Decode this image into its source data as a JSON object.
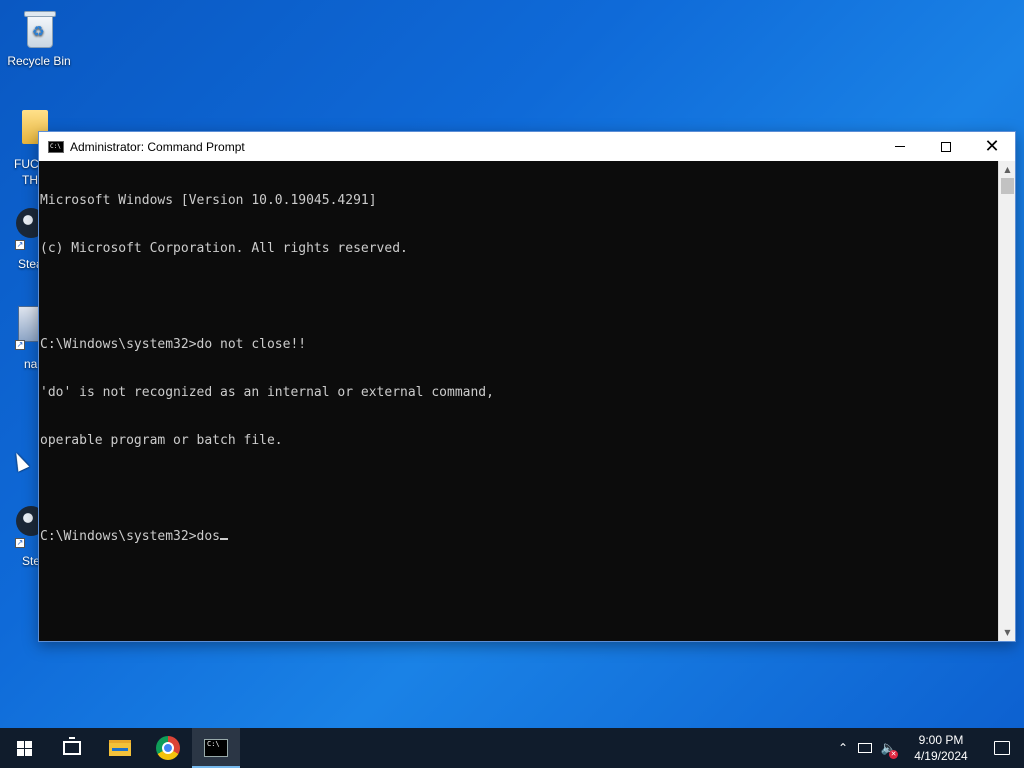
{
  "desktop": {
    "recycle_bin_label": "Recycle Bin",
    "partial_labels": [
      "FUCI",
      "THI",
      "Stea",
      "na",
      "Ste"
    ]
  },
  "window": {
    "title": "Administrator: Command Prompt",
    "icon_text": "C:\\",
    "controls": [
      "minimize",
      "maximize",
      "close"
    ]
  },
  "console": {
    "lines": [
      "Microsoft Windows [Version 10.0.19045.4291]",
      "(c) Microsoft Corporation. All rights reserved.",
      "",
      "C:\\Windows\\system32>do not close!!",
      "'do' is not recognized as an internal or external command,",
      "operable program or batch file.",
      "",
      "C:\\Windows\\system32>dos"
    ]
  },
  "taskbar": {
    "apps": [
      {
        "name": "start",
        "icon": "windows-logo-icon"
      },
      {
        "name": "task-view",
        "icon": "task-view-icon"
      },
      {
        "name": "file-explorer",
        "icon": "folder-icon"
      },
      {
        "name": "chrome",
        "icon": "chrome-icon"
      },
      {
        "name": "command-prompt",
        "icon": "cmd-icon",
        "active": true
      }
    ],
    "tray": {
      "time": "9:00 PM",
      "date": "4/19/2024"
    }
  },
  "colors": {
    "desktop_bg": "#0f6ad8",
    "console_bg": "#0c0c0c",
    "console_text": "#cccccc",
    "taskbar_bg": "#101c2c",
    "active_indicator": "#76b9ed"
  }
}
